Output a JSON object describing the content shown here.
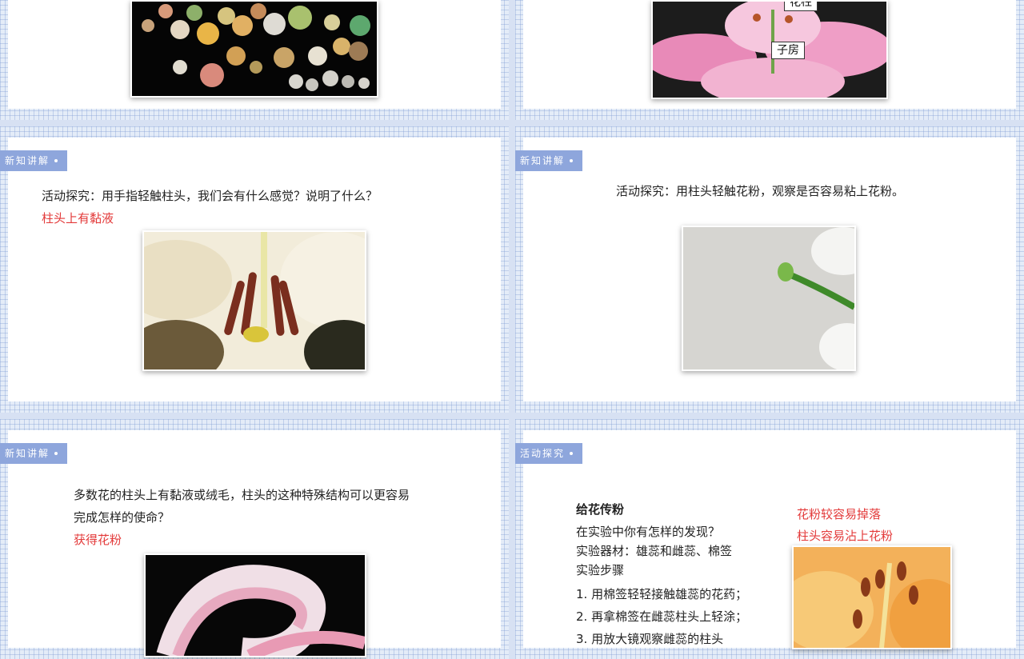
{
  "slides": {
    "top_left": {},
    "top_right": {
      "labels": {
        "style": "花柱",
        "ovary": "子房"
      }
    },
    "mid_left": {
      "tag": "新知讲解",
      "question": "活动探究：用手指轻触柱头，我们会有什么感觉？说明了什么？",
      "answer": "柱头上有黏液"
    },
    "mid_right": {
      "tag": "新知讲解",
      "question": "活动探究：用柱头轻触花粉，观察是否容易粘上花粉。"
    },
    "bottom_left": {
      "tag": "新知讲解",
      "line1": "多数花的柱头上有黏液或绒毛，柱头的这种特殊结构可以更容易",
      "line2": "完成怎样的使命？",
      "answer": "获得花粉"
    },
    "bottom_right": {
      "tag": "活动探究",
      "title": "给花传粉",
      "q": "在实验中你有怎样的发现？",
      "materials": "实验器材：雄蕊和雌蕊、棉签",
      "steps_title": " 实验步骤",
      "steps": [
        "1. 用棉签轻轻接触雄蕊的花药；",
        "2. 再拿棉签在雌蕊柱头上轻涂；",
        "3. 用放大镜观察雌蕊的柱头"
      ],
      "finding1": "花粉较容易掉落",
      "finding2": "柱头容易沾上花粉"
    }
  },
  "colors": {
    "accent": "#8ea6dc",
    "answer_red": "#e33a3a"
  }
}
